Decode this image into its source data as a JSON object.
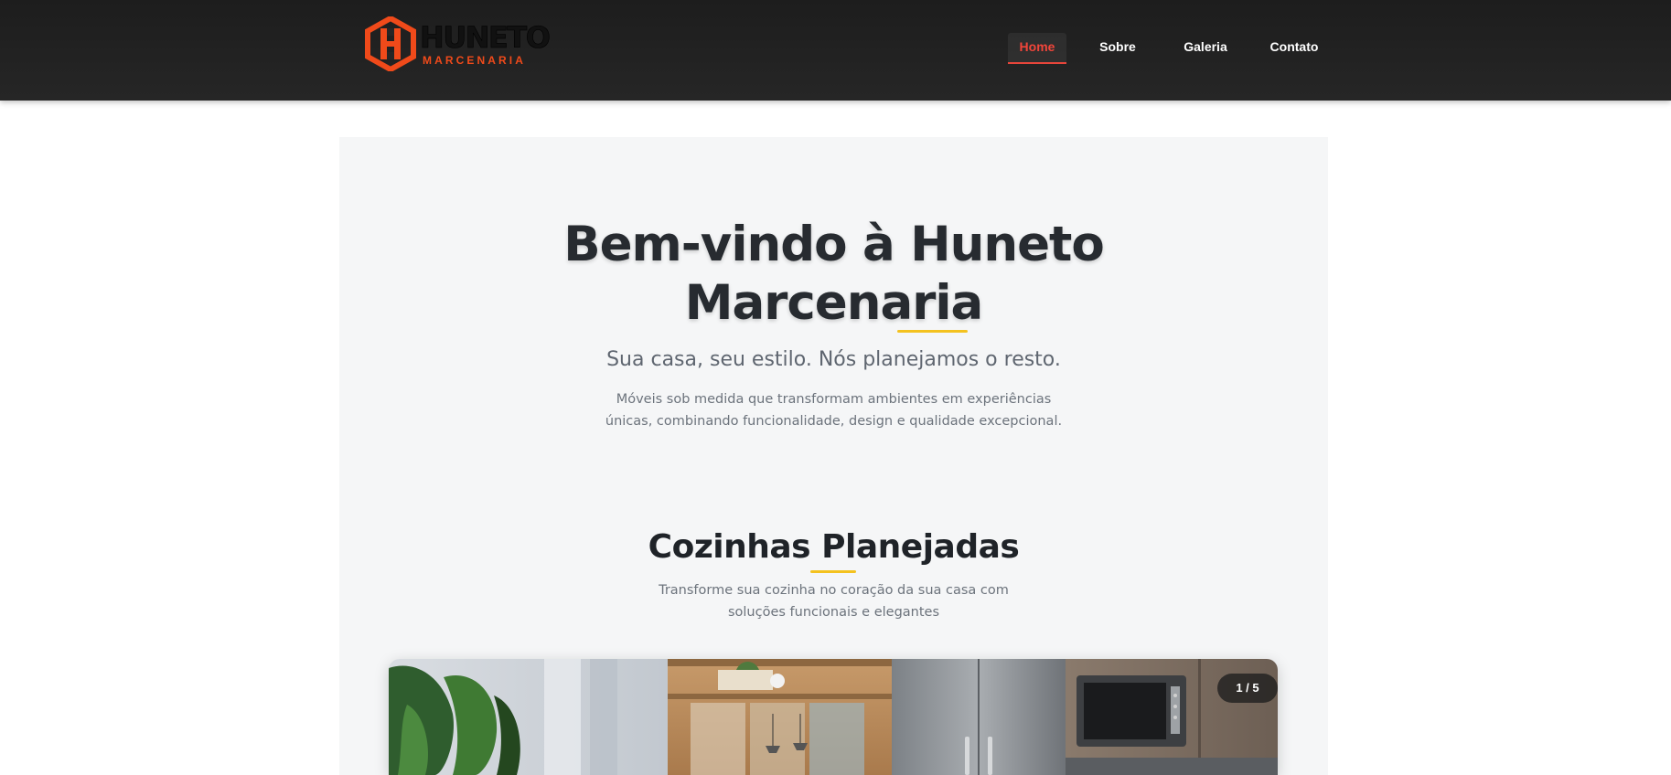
{
  "header": {
    "logo": {
      "word": "HUNETO",
      "sub": "MARCENARIA",
      "icon": "huneto-hexagon-logo",
      "brand_color": "#f04a1a"
    },
    "nav": [
      {
        "label": "Home",
        "active": true
      },
      {
        "label": "Sobre",
        "active": false
      },
      {
        "label": "Galeria",
        "active": false
      },
      {
        "label": "Contato",
        "active": false
      }
    ],
    "active_color": "#e8453a"
  },
  "hero": {
    "title_line1": "Bem-vindo à Huneto",
    "title_line2": "Marcenaria",
    "subtitle": "Sua casa, seu estilo. Nós planejamos o resto.",
    "description": "Móveis sob medida que transformam ambientes em experiências únicas, combinando funcionalidade, design e qualidade excepcional.",
    "accent_color": "#f4c21f"
  },
  "section": {
    "title": "Cozinhas Planejadas",
    "description": "Transforme sua cozinha no coração da sua casa com soluções funcionais e elegantes"
  },
  "carousel": {
    "counter": "1 / 5",
    "current": 1,
    "total": 5,
    "image": "kitchen-photo"
  }
}
